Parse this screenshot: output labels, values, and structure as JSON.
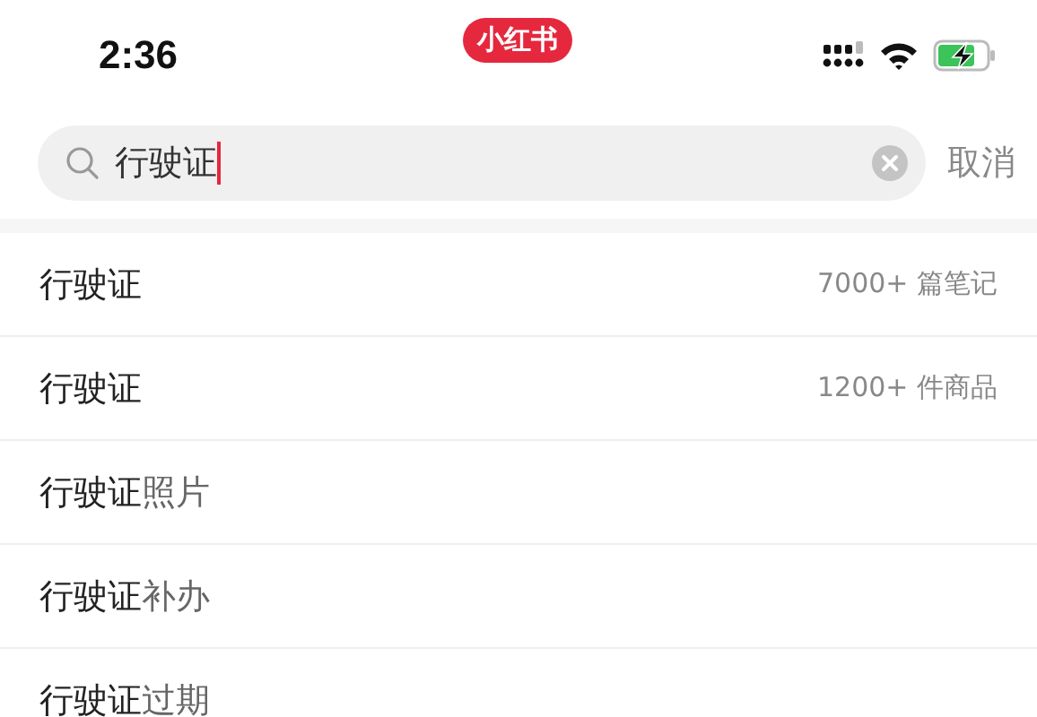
{
  "status_bar": {
    "time": "2:36",
    "app_badge": "小红书"
  },
  "search": {
    "value": "行驶证",
    "cancel": "取消"
  },
  "suggestions": [
    {
      "match": "行驶证",
      "count": "7000+ 篇笔记"
    },
    {
      "match": "行驶证",
      "count": "1200+ 件商品"
    },
    {
      "match": "行驶证",
      "suffix": "照片"
    },
    {
      "match": "行驶证",
      "suffix": "补办"
    },
    {
      "match": "行驶证",
      "suffix": "过期"
    }
  ]
}
